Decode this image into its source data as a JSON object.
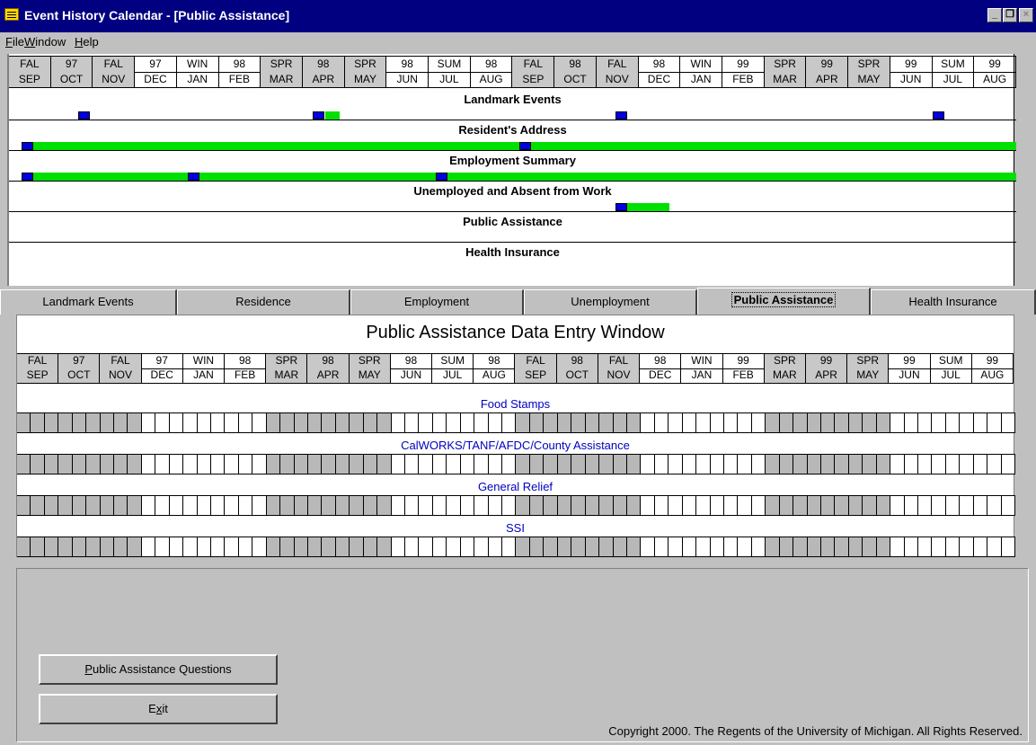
{
  "window": {
    "title": "Event History Calendar - [Public Assistance]",
    "controls": {
      "minimize": "_",
      "restore": "❐",
      "close": "×"
    }
  },
  "menu": [
    {
      "label": "File",
      "key": "F",
      "rest": "ile"
    },
    {
      "label": "Window",
      "key": "W",
      "rest": "indow"
    },
    {
      "label": "Help",
      "key": "H",
      "rest": "elp"
    }
  ],
  "calendar": {
    "seasons": [
      "FAL",
      "97",
      "FAL",
      "97",
      "WIN",
      "98",
      "SPR",
      "98",
      "SPR",
      "98",
      "SUM",
      "98",
      "FAL",
      "98",
      "FAL",
      "98",
      "WIN",
      "99",
      "SPR",
      "99",
      "SPR",
      "99",
      "SUM",
      "99"
    ],
    "months": [
      "SEP",
      "OCT",
      "NOV",
      "DEC",
      "JAN",
      "FEB",
      "MAR",
      "APR",
      "MAY",
      "JUN",
      "JUL",
      "AUG",
      "SEP",
      "OCT",
      "NOV",
      "DEC",
      "JAN",
      "FEB",
      "MAR",
      "APR",
      "MAY",
      "JUN",
      "JUL",
      "AUG"
    ],
    "sections": [
      "Landmark Events",
      "Resident's Address",
      "Employment Summary",
      "Unemployed and Absent from Work",
      "Public Assistance",
      "Health Insurance"
    ]
  },
  "tabs": [
    "Landmark Events",
    "Residence",
    "Employment",
    "Unemployment",
    "Public Assistance",
    "Health Insurance"
  ],
  "active_tab": "Public Assistance",
  "entry": {
    "title": "Public Assistance Data Entry Window",
    "programs": [
      "Food Stamps",
      "CalWORKS/TANF/AFDC/County Assistance",
      "General Relief",
      "SSI"
    ]
  },
  "buttons": {
    "questions": {
      "key": "P",
      "rest": "ublic Assistance Questions"
    },
    "exit": {
      "pre": "E",
      "key": "x",
      "rest": "it"
    }
  },
  "copyright": "Copyright 2000.  The Regents of the University of Michigan.  All Rights Reserved.",
  "colors": {
    "titlebar": "#000080",
    "bar": "#00e000",
    "marker": "#0000e0",
    "program_label": "#0000c0"
  }
}
